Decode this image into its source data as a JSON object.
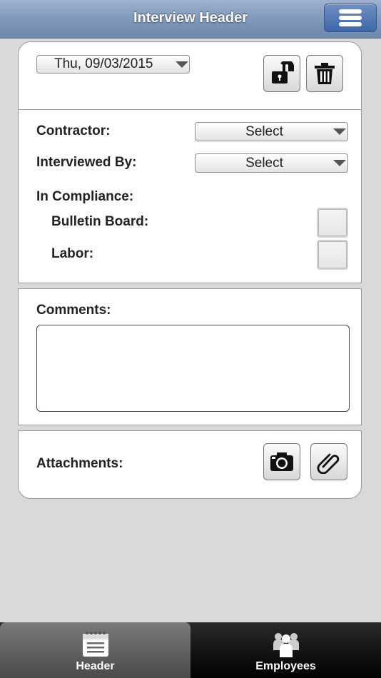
{
  "header": {
    "title": "Interview Header",
    "menu_icon": "hamburger-icon"
  },
  "form": {
    "date": "Thu, 09/03/2015",
    "lock_icon": "unlock-icon",
    "delete_icon": "trash-icon",
    "contractor_label": "Contractor:",
    "contractor_value": "Select",
    "interviewed_by_label": "Interviewed By:",
    "interviewed_by_value": "Select",
    "compliance_label": "In Compliance:",
    "bulletin_board_label": "Bulletin Board:",
    "bulletin_board_checked": false,
    "labor_label": "Labor:",
    "labor_checked": false
  },
  "comments": {
    "label": "Comments:",
    "value": ""
  },
  "attachments": {
    "label": "Attachments:",
    "camera_icon": "camera-icon",
    "paperclip_icon": "paperclip-icon"
  },
  "tabs": [
    {
      "label": "Header",
      "icon": "notepad-icon",
      "active": true
    },
    {
      "label": "Employees",
      "icon": "people-icon",
      "active": false
    }
  ],
  "colors": {
    "topbar": "#7f98bb",
    "menu_button": "#4a6fae",
    "background": "#d9d9d9",
    "tabbar": "#000000"
  }
}
